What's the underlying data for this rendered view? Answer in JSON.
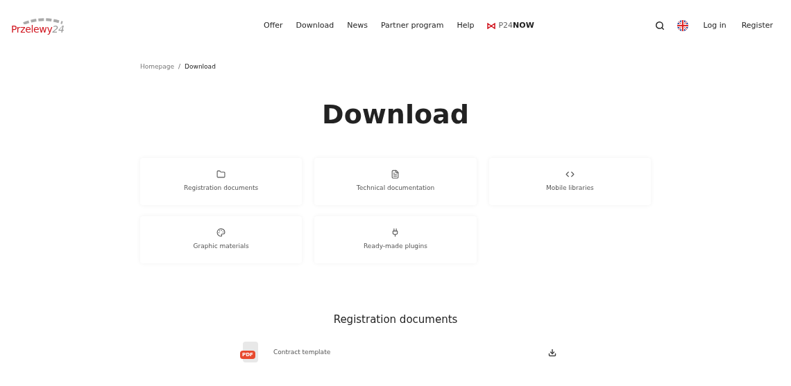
{
  "header": {
    "logo": {
      "name": "Przelewy",
      "number": "24"
    },
    "nav": [
      {
        "kind": "link",
        "label": "Offer"
      },
      {
        "kind": "link",
        "label": "Download"
      },
      {
        "kind": "link",
        "label": "News"
      },
      {
        "kind": "link",
        "label": "Partner program"
      },
      {
        "kind": "link",
        "label": "Help"
      },
      {
        "kind": "brand",
        "prefix": "P24",
        "label": "NOW"
      }
    ],
    "actions": [
      {
        "kind": "search"
      },
      {
        "kind": "flag"
      },
      {
        "kind": "link",
        "label": "Log in"
      },
      {
        "kind": "link",
        "label": "Register"
      }
    ]
  },
  "breadcrumb": {
    "separator": "/",
    "items": [
      {
        "label": "Homepage",
        "current": false
      },
      {
        "label": "Download",
        "current": true
      }
    ]
  },
  "title": "Download",
  "categories": [
    {
      "kind": "folder",
      "label": "Registration documents"
    },
    {
      "kind": "file",
      "label": "Technical documentation"
    },
    {
      "kind": "code",
      "label": "Mobile libraries"
    },
    {
      "kind": "palette",
      "label": "Graphic materials"
    },
    {
      "kind": "plug",
      "label": "Ready-made plugins"
    }
  ],
  "section": {
    "title": "Registration documents",
    "files": [
      {
        "badge": "PDF",
        "name": "Contract template"
      }
    ]
  }
}
